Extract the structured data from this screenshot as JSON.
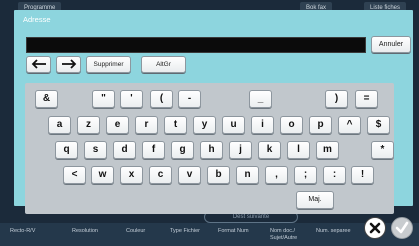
{
  "background": {
    "tabs": [
      "Programme",
      "Bok fax",
      "Liste fiches"
    ],
    "bottom_pill": "Dest suivante",
    "footer_columns": [
      "Recto-R/V",
      "Resolution",
      "Couleur",
      "Type Fichier",
      "Format Num",
      "Nom doc./ Sujet/Autre",
      "Num. separee"
    ]
  },
  "dialog": {
    "title": "Adresse",
    "input_value": "",
    "cancel_label": "Annuler",
    "delete_label": "Supprimer",
    "altgr_label": "AltGr"
  },
  "keyboard": {
    "row1": [
      "&",
      "\"",
      "'",
      "(",
      "-",
      "_",
      ")",
      "="
    ],
    "row2": [
      "a",
      "z",
      "e",
      "r",
      "t",
      "y",
      "u",
      "i",
      "o",
      "p",
      "^",
      "$"
    ],
    "row3": [
      "q",
      "s",
      "d",
      "f",
      "g",
      "h",
      "j",
      "k",
      "l",
      "m",
      "*"
    ],
    "row4": [
      "<",
      "w",
      "x",
      "c",
      "v",
      "b",
      "n",
      ",",
      ";",
      ":",
      "!"
    ],
    "shift_label": "Maj."
  }
}
